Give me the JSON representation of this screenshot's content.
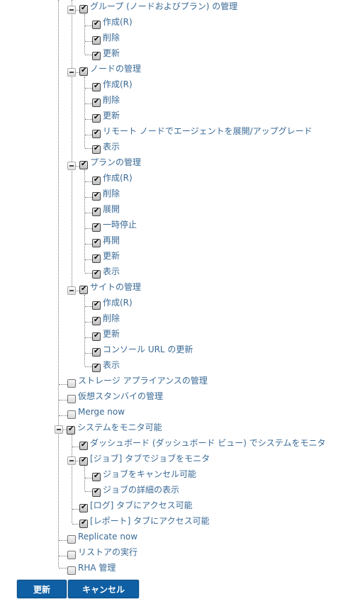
{
  "tree": {
    "group_mgmt": {
      "label": "グループ (ノードおよびプラン) の管理",
      "checked": true,
      "expanded": true,
      "children": [
        {
          "label": "作成(R)",
          "checked": true
        },
        {
          "label": "削除",
          "checked": true
        },
        {
          "label": "更新",
          "checked": true
        }
      ]
    },
    "node_mgmt": {
      "label": "ノードの管理",
      "checked": true,
      "expanded": true,
      "children": [
        {
          "label": "作成(R)",
          "checked": true
        },
        {
          "label": "削除",
          "checked": true
        },
        {
          "label": "更新",
          "checked": true
        },
        {
          "label": "リモート ノードでエージェントを展開/アップグレード",
          "checked": true
        },
        {
          "label": "表示",
          "checked": true
        }
      ]
    },
    "plan_mgmt": {
      "label": "プランの管理",
      "checked": true,
      "expanded": true,
      "children": [
        {
          "label": "作成(R)",
          "checked": true
        },
        {
          "label": "削除",
          "checked": true
        },
        {
          "label": "展開",
          "checked": true
        },
        {
          "label": "一時停止",
          "checked": true
        },
        {
          "label": "再開",
          "checked": true
        },
        {
          "label": "更新",
          "checked": true
        },
        {
          "label": "表示",
          "checked": true
        }
      ]
    },
    "site_mgmt": {
      "label": "サイトの管理",
      "checked": true,
      "expanded": true,
      "children": [
        {
          "label": "作成(R)",
          "checked": true
        },
        {
          "label": "削除",
          "checked": true
        },
        {
          "label": "更新",
          "checked": true
        },
        {
          "label": "コンソール URL の更新",
          "checked": true
        },
        {
          "label": "表示",
          "checked": true
        }
      ]
    },
    "storage_appliance": {
      "label": "ストレージ アプライアンスの管理",
      "checked": false
    },
    "virtual_standby": {
      "label": "仮想スタンバイの管理",
      "checked": false
    },
    "merge_now": {
      "label": "Merge now",
      "checked": false
    },
    "monitor": {
      "label": "システムをモニタ可能",
      "checked": true,
      "expanded": true,
      "dashboard": {
        "label": "ダッシュボード (ダッシュボード ビュー) でシステムをモニタ",
        "checked": true
      },
      "jobs_tab": {
        "label": "[ジョブ] タブでジョブをモニタ",
        "checked": true,
        "expanded": true,
        "children": [
          {
            "label": "ジョブをキャンセル可能",
            "checked": true
          },
          {
            "label": "ジョブの詳細の表示",
            "checked": true
          }
        ]
      },
      "log_tab": {
        "label": "[ログ] タブにアクセス可能",
        "checked": true
      },
      "report_tab": {
        "label": "[レポート] タブにアクセス可能",
        "checked": true
      }
    },
    "replicate_now": {
      "label": "Replicate now",
      "checked": false
    },
    "run_restore": {
      "label": "リストアの実行",
      "checked": false
    },
    "rha_mgmt": {
      "label": "RHA 管理",
      "checked": false
    }
  },
  "buttons": {
    "update": "更新",
    "cancel": "キャンセル"
  },
  "colors": {
    "link_text": "#3a6a96",
    "button_bg": "#0e5fa3"
  }
}
